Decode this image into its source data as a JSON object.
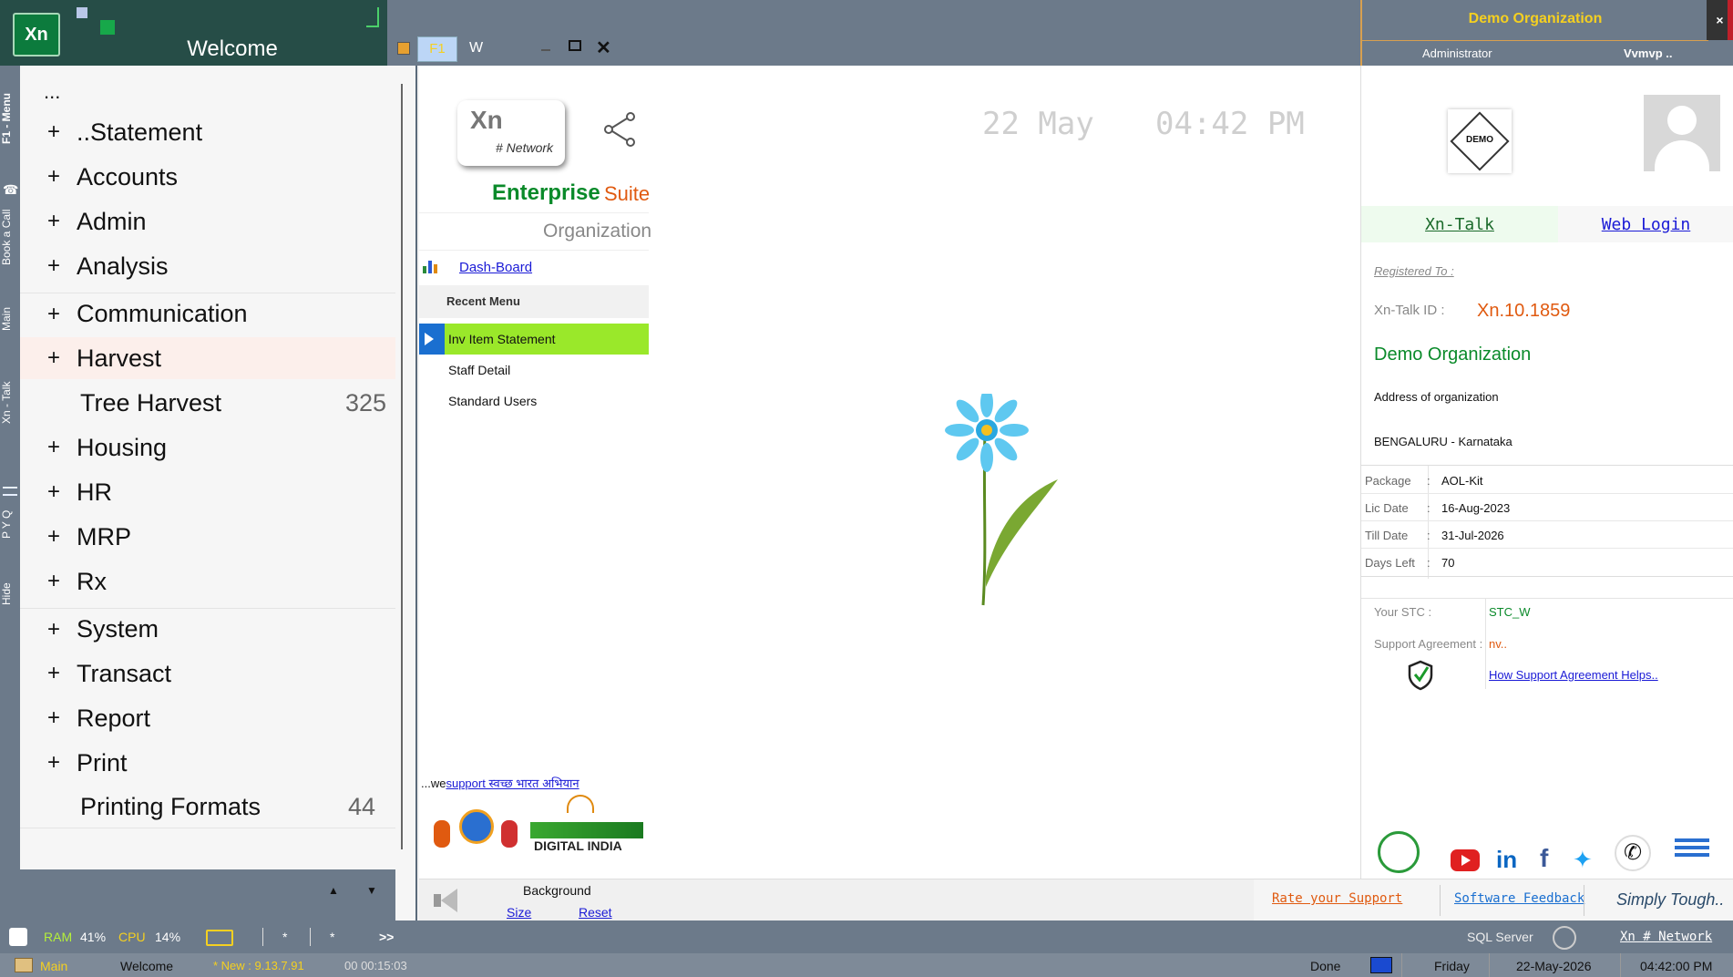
{
  "titlebar": {
    "welcome": "Welcome",
    "logo": "Xn",
    "tabs": [
      "F1",
      "W"
    ]
  },
  "org_header": {
    "name": "Demo Organization",
    "role": "Administrator",
    "user": "Vvmvp ..",
    "close": "×"
  },
  "side_tabs": [
    "F1 - Menu",
    "Book a Call",
    "Main",
    "Xn - Talk",
    "P Y Q",
    "Hide"
  ],
  "menu": {
    "top": "...",
    "items": [
      {
        "plus": "+",
        "label": "..Statement"
      },
      {
        "plus": "+",
        "label": "Accounts"
      },
      {
        "plus": "+",
        "label": "Admin"
      },
      {
        "plus": "+",
        "label": "Analysis"
      },
      {
        "plus": "+",
        "label": "Communication"
      },
      {
        "plus": "+",
        "label": "Harvest"
      },
      {
        "plus": "",
        "label": "Tree Harvest",
        "count": "325"
      },
      {
        "plus": "+",
        "label": "Housing"
      },
      {
        "plus": "+",
        "label": "HR"
      },
      {
        "plus": "+",
        "label": "MRP"
      },
      {
        "plus": "+",
        "label": "Rx"
      },
      {
        "plus": "+",
        "label": "System"
      },
      {
        "plus": "+",
        "label": "Transact"
      },
      {
        "plus": "+",
        "label": "Report"
      },
      {
        "plus": "+",
        "label": "Print"
      },
      {
        "plus": "",
        "label": "Printing Formats",
        "count": "44"
      }
    ]
  },
  "center": {
    "logo_xn": "Xn",
    "logo_network": "# Network",
    "enterprise": "Enterprise",
    "suite": "Suite",
    "organization": "Organization",
    "date": "22 May",
    "time": "04:42 PM",
    "dashboard": "Dash-Board",
    "recent_menu": "Recent Menu",
    "recent": [
      "Inv Item Statement",
      "Staff Detail",
      "Standard Users"
    ],
    "we_support": "...we",
    "support_link": "support स्वच्छ भारत अभियान",
    "digital_india": "DIGITAL INDIA",
    "background": "Background",
    "size": "Size",
    "reset": "Reset"
  },
  "right": {
    "demo": "DEMO",
    "xn_talk": "Xn-Talk",
    "web_login": "Web Login",
    "registered_to": "Registered To :",
    "xn_talk_id_label": "Xn-Talk ID :",
    "xn_talk_id": "Xn.10.1859",
    "org_name": "Demo Organization",
    "address": "Address of organization",
    "city": "BENGALURU - Karnataka",
    "details": [
      {
        "k": "Package",
        "v": "AOL-Kit"
      },
      {
        "k": "Lic Date",
        "v": "16-Aug-2023"
      },
      {
        "k": "Till Date",
        "v": "31-Jul-2026"
      },
      {
        "k": "Days Left",
        "v": "70"
      }
    ],
    "stc_label": "Your STC :",
    "stc": "STC_W",
    "support_label": "Support Agreement :",
    "support": "nv..",
    "support_help": "How Support Agreement Helps.."
  },
  "footer_links": {
    "rate": "Rate your Support",
    "feedback": "Software Feedback",
    "tagline": "Simply Tough.."
  },
  "status1": {
    "ram_label": "RAM",
    "ram": "41%",
    "cpu_label": "CPU",
    "cpu": "14%",
    "star1": "*",
    "star2": "*",
    "more": ">>",
    "sql": "SQL Server",
    "network": "Xn # Network"
  },
  "status2": {
    "main": "Main",
    "welcome": "Welcome",
    "new": "* New : 9.13.7.91",
    "elapsed": "00 00:15:03",
    "done": "Done",
    "day": "Friday",
    "date": "22-May-2026",
    "time": "04:42:00 PM"
  },
  "colors": {
    "accent_green": "#0a8a2a",
    "accent_orange": "#e05a10",
    "highlight": "#9ae82a"
  }
}
